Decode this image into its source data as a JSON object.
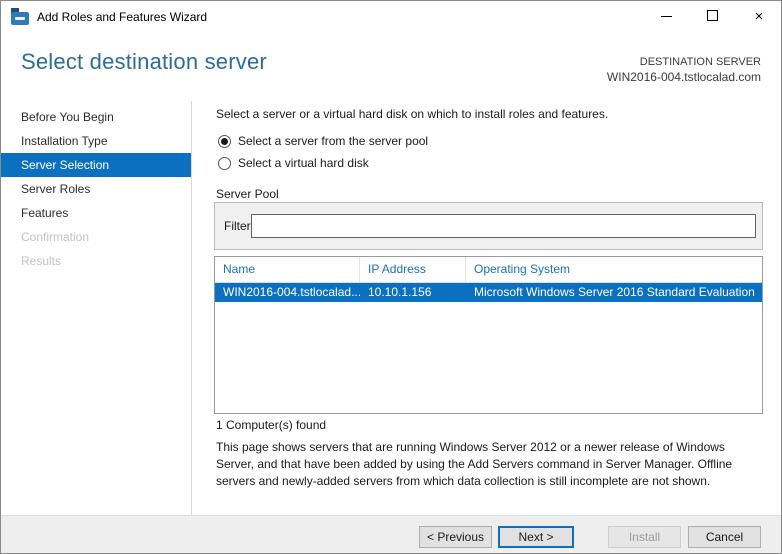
{
  "window": {
    "title": "Add Roles and Features Wizard"
  },
  "icons": {
    "close": "×",
    "minimize": "minimize-icon",
    "maximize": "maximize-icon",
    "app": "server-manager-icon"
  },
  "header": {
    "title": "Select destination server",
    "destination_label": "DESTINATION SERVER",
    "destination_server": "WIN2016-004.tstlocalad.com"
  },
  "sidebar": {
    "items": [
      {
        "label": "Before You Begin",
        "state": "enabled"
      },
      {
        "label": "Installation Type",
        "state": "enabled"
      },
      {
        "label": "Server Selection",
        "state": "active"
      },
      {
        "label": "Server Roles",
        "state": "enabled"
      },
      {
        "label": "Features",
        "state": "enabled"
      },
      {
        "label": "Confirmation",
        "state": "disabled"
      },
      {
        "label": "Results",
        "state": "disabled"
      }
    ]
  },
  "main": {
    "intro": "Select a server or a virtual hard disk on which to install roles and features.",
    "radio_options": [
      {
        "label": "Select a server from the server pool",
        "selected": true
      },
      {
        "label": "Select a virtual hard disk",
        "selected": false
      }
    ],
    "server_pool": {
      "label": "Server Pool",
      "filter_label": "Filter:",
      "filter_value": ""
    },
    "table": {
      "columns": [
        "Name",
        "IP Address",
        "Operating System"
      ],
      "rows": [
        [
          "WIN2016-004.tstlocalad....",
          "10.10.1.156",
          "Microsoft Windows Server 2016 Standard Evaluation"
        ]
      ],
      "selected_row": 0
    },
    "found": "1 Computer(s) found",
    "description": "This page shows servers that are running Windows Server 2012 or a newer release of Windows Server, and that have been added by using the Add Servers command in Server Manager. Offline servers and newly-added servers from which data collection is still incomplete are not shown."
  },
  "footer": {
    "previous": "< Previous",
    "next": "Next >",
    "install": "Install",
    "cancel": "Cancel"
  },
  "colors": {
    "accent": "#0c70c0",
    "table_header_blue": "#1d70b8",
    "page_title_blue": "#2d6c96",
    "footer_bg": "#eeeeee",
    "groupbox_bg": "#f0f0f0"
  }
}
